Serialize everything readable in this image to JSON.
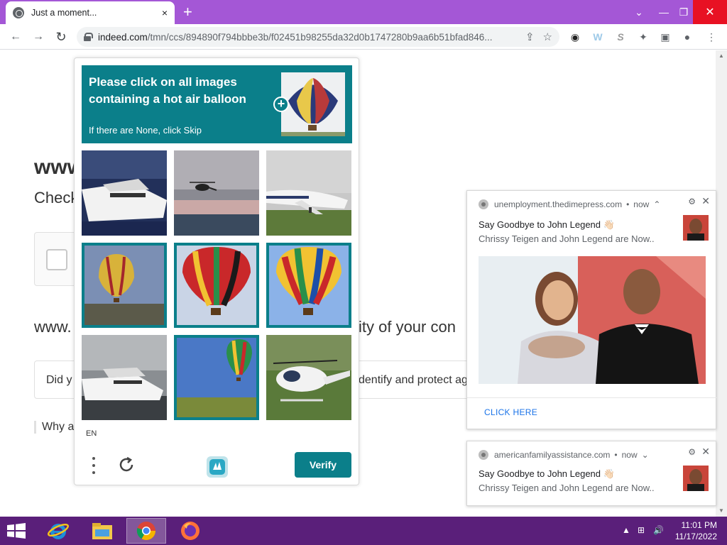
{
  "browser": {
    "tab_title": "Just a moment...",
    "url_host": "indeed.com",
    "url_path": "/tmn/ccs/894890f794bbbe3b/f02451b98255da32d0b1747280b9aa6b51bfad846...",
    "close_glyph": "×",
    "newtab_glyph": "+",
    "window": {
      "chevron": "⌄",
      "minimize": "—",
      "maximize": "❐",
      "close": "✕"
    },
    "nav": {
      "back": "←",
      "forward": "→",
      "reload": "↻"
    },
    "omnibox_icons": {
      "share": "⇪",
      "star": "☆"
    },
    "extensions": [
      "◉",
      "W",
      "S",
      "✦",
      "▣",
      "●",
      "⋮"
    ]
  },
  "page": {
    "heading": "www",
    "subheading": "Check",
    "line_left": "www.",
    "line_right": "ity of your con",
    "card_left": "Did y",
    "card_right": "dentify and protect ag",
    "why": "Why a"
  },
  "captcha": {
    "prompt": "Please click on all images containing a hot air balloon",
    "sub": "If there are None, click Skip",
    "plus": "+",
    "language": "EN",
    "verify_label": "Verify",
    "tiles": [
      {
        "subject": "yacht",
        "selected": false
      },
      {
        "subject": "helicopter",
        "selected": false
      },
      {
        "subject": "airplane",
        "selected": false
      },
      {
        "subject": "hot-air-balloon",
        "selected": true
      },
      {
        "subject": "hot-air-balloon",
        "selected": true
      },
      {
        "subject": "hot-air-balloon",
        "selected": true
      },
      {
        "subject": "yacht",
        "selected": false
      },
      {
        "subject": "hot-air-balloon",
        "selected": true
      },
      {
        "subject": "helicopter",
        "selected": false
      }
    ],
    "accent": "#0b7f8a"
  },
  "notifications": [
    {
      "source": "unemployment.thedimepress.com",
      "time": "now",
      "chevron": "⌃",
      "title": "Say Goodbye to John Legend 👋🏻",
      "body": "Chrissy Teigen and John Legend are Now..",
      "action": "CLICK HERE",
      "gear": "⚙",
      "close": "✕"
    },
    {
      "source": "americanfamilyassistance.com",
      "time": "now",
      "chevron": "⌄",
      "title": "Say Goodbye to John Legend 👋🏻",
      "body": "Chrissy Teigen and John Legend are Now..",
      "gear": "⚙",
      "close": "✕"
    }
  ],
  "taskbar": {
    "time": "11:01 PM",
    "date": "11/17/2022",
    "tray": [
      "▲",
      "⊞",
      "🔊"
    ]
  },
  "colors": {
    "titlebar": "#a457d6",
    "taskbar": "#5a1f7a",
    "captcha_accent": "#0b7f8a",
    "close_red": "#e81123"
  }
}
